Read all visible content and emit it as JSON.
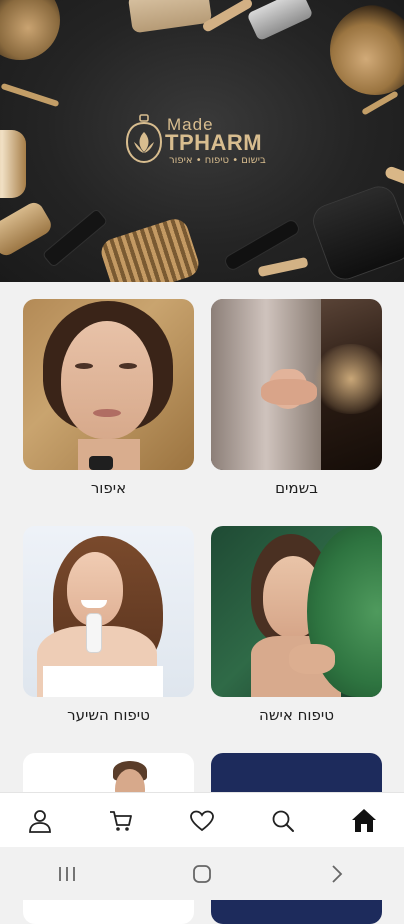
{
  "hero": {
    "logo_made": "Made",
    "logo_brand": "TPHARM",
    "logo_tagline": "בישום • טיפוח • איפור"
  },
  "categories": [
    {
      "label": "בשמים",
      "image": "perfume-photo"
    },
    {
      "label": "איפור",
      "image": "makeup-photo"
    },
    {
      "label": "טיפוח אישה",
      "image": "skincare-photo"
    },
    {
      "label": "טיפוח השיער",
      "image": "haircare-photo"
    },
    {
      "label": "",
      "image": "navy-banner"
    },
    {
      "label": "",
      "image": "men-photo"
    }
  ],
  "bottom_nav": {
    "items": [
      {
        "name": "home",
        "icon": "home-icon",
        "active": true
      },
      {
        "name": "search",
        "icon": "search-icon"
      },
      {
        "name": "favorites",
        "icon": "heart-icon"
      },
      {
        "name": "cart",
        "icon": "cart-icon"
      },
      {
        "name": "account",
        "icon": "user-icon"
      }
    ]
  },
  "system_nav": {
    "items": [
      "recent-apps-icon",
      "home-circle-icon",
      "back-chevron-icon"
    ]
  },
  "colors": {
    "gold": "#d8bd8f",
    "hero_bg": "#242424",
    "page_bg": "#f1f1f1",
    "text": "#1e1e1e"
  }
}
